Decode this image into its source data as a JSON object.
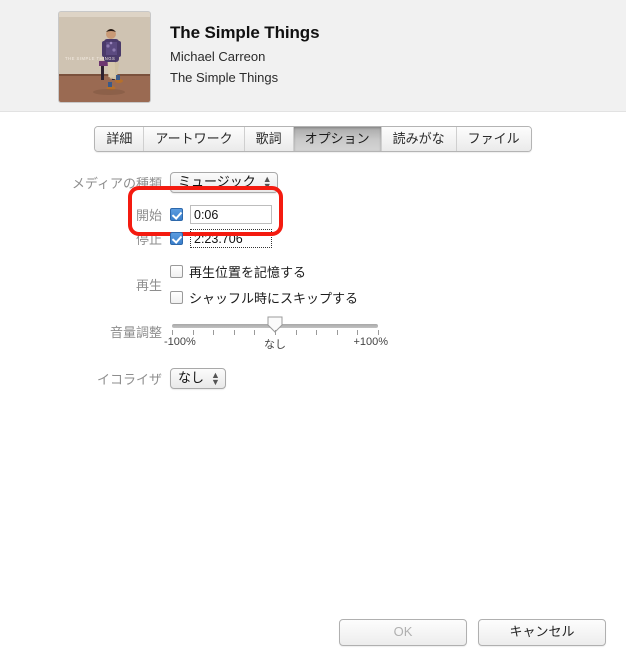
{
  "header": {
    "track_title": "The Simple Things",
    "artist": "Michael Carreon",
    "album": "The Simple Things",
    "artwork_caption": "THE SIMPLE THINGS"
  },
  "tabs": [
    {
      "label": "詳細",
      "selected": false
    },
    {
      "label": "アートワーク",
      "selected": false
    },
    {
      "label": "歌詞",
      "selected": false
    },
    {
      "label": "オプション",
      "selected": true
    },
    {
      "label": "読みがな",
      "selected": false
    },
    {
      "label": "ファイル",
      "selected": false
    }
  ],
  "form": {
    "media_kind": {
      "label": "メディアの種類",
      "value": "ミュージック"
    },
    "start": {
      "label": "開始",
      "checked": true,
      "value": "0:06"
    },
    "stop": {
      "label": "停止",
      "checked": true,
      "value": "2:23.706"
    },
    "playback": {
      "label": "再生",
      "remember_position": {
        "label": "再生位置を記憶する",
        "checked": false
      },
      "skip_when_shuffling": {
        "label": "シャッフル時にスキップする",
        "checked": false
      }
    },
    "volume": {
      "label": "音量調整",
      "min_label": "-100%",
      "mid_label": "なし",
      "max_label": "+100%",
      "value": 0
    },
    "equalizer": {
      "label": "イコライザ",
      "value": "なし"
    }
  },
  "footer": {
    "ok_label": "OK",
    "cancel_label": "キャンセル"
  },
  "colors": {
    "highlight": "#f41b10",
    "checkbox_accent": "#3a7fcb",
    "header_bg": "#f1f1f1"
  }
}
